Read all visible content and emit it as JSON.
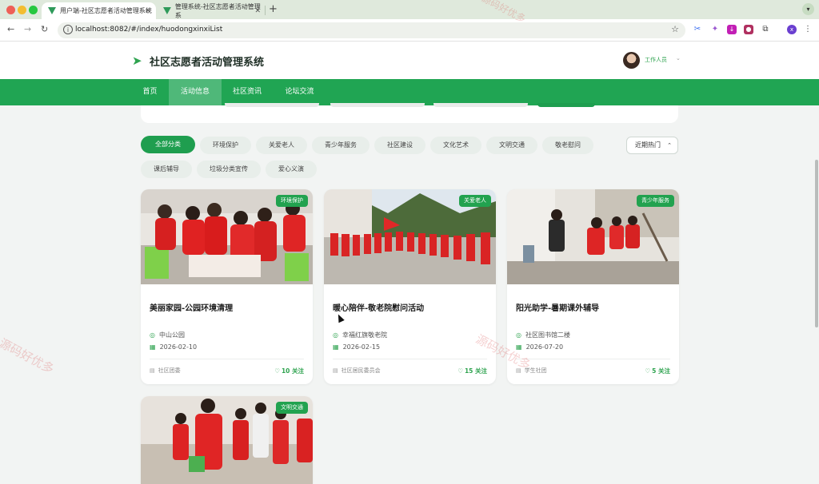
{
  "browser": {
    "tabs": [
      {
        "title": "用户端-社区志愿者活动管理系统",
        "active": true
      },
      {
        "title": "管理系统-社区志愿者活动管理系",
        "active": false
      }
    ],
    "url": "localhost:8082/#/index/huodongxinxiList",
    "colors": {
      "tab_bar": "#dfe9dc"
    }
  },
  "site": {
    "title": "社区志愿者活动管理系统",
    "user_role": "工作人员",
    "nav": [
      {
        "label": "首页",
        "active": false
      },
      {
        "label": "活动信息",
        "active": true
      },
      {
        "label": "社区资讯",
        "active": false
      },
      {
        "label": "论坛交流",
        "active": false
      }
    ],
    "colors": {
      "brand": "#20a553",
      "nav_active": "#4fb879"
    }
  },
  "filters": {
    "chips": [
      {
        "label": "全部分类",
        "active": true
      },
      {
        "label": "环境保护",
        "active": false
      },
      {
        "label": "关爱老人",
        "active": false
      },
      {
        "label": "青少年服务",
        "active": false
      },
      {
        "label": "社区建设",
        "active": false
      },
      {
        "label": "文化艺术",
        "active": false
      },
      {
        "label": "文明交通",
        "active": false
      },
      {
        "label": "敬老慰问",
        "active": false
      },
      {
        "label": "课后辅导",
        "active": false
      },
      {
        "label": "垃圾分类宣传",
        "active": false
      },
      {
        "label": "爱心义演",
        "active": false
      }
    ],
    "sort": "近期热门"
  },
  "cards": [
    {
      "badge": "环境保护",
      "title": "美丽家园-公园环境清理",
      "location": "中山公园",
      "date": "2026-02-10",
      "org": "社区团委",
      "follows": "10 关注"
    },
    {
      "badge": "关爱老人",
      "title": "暖心陪伴-敬老院慰问活动",
      "location": "幸福红旗敬老院",
      "date": "2026-02-15",
      "org": "社区居民委员会",
      "follows": "15 关注"
    },
    {
      "badge": "青少年服务",
      "title": "阳光助学-暑期课外辅导",
      "location": "社区图书馆二楼",
      "date": "2026-07-20",
      "org": "学生社团",
      "follows": "5 关注"
    },
    {
      "badge": "文明交通"
    }
  ],
  "watermark": "源码好优多"
}
